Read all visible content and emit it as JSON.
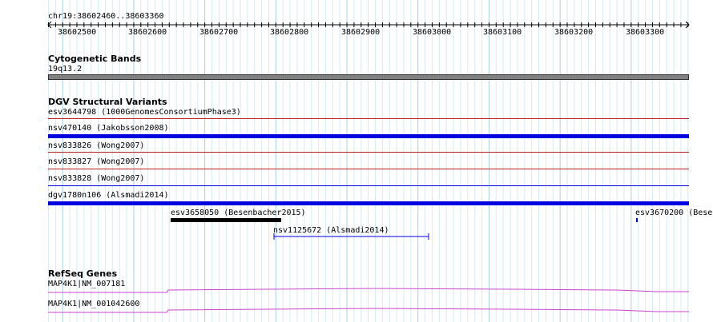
{
  "ruler": {
    "region_label": "chr19:38602460..38603360",
    "ticks": [
      "38602500",
      "38602600",
      "38602700",
      "38602800",
      "38602900",
      "38603000",
      "38603100",
      "38603200",
      "38603300"
    ]
  },
  "cytoband": {
    "title": "Cytogenetic Bands",
    "band_label": "19q13.2"
  },
  "dgv": {
    "title": "DGV Structural Variants",
    "items": [
      {
        "label": "esv3644798 (1000GenomesConsortiumPhase3)",
        "color": "#b22222"
      },
      {
        "label": "nsv470140 (Jakobsson2008)",
        "color": "#0000e0"
      },
      {
        "label": "nsv833826 (Wong2007)",
        "color": "#b22222"
      },
      {
        "label": "nsv833827 (Wong2007)",
        "color": "#b22222"
      },
      {
        "label": "nsv833828 (Wong2007)",
        "color": "#0000e0"
      },
      {
        "label": "dgv1780n106 (Alsmadi2014)",
        "color": "#0000e0"
      },
      {
        "label": "esv3658050 (Besenbacher2015)",
        "color": "#000000"
      },
      {
        "label": "nsv1125672 (Alsmadi2014)",
        "color": "#0000e0"
      },
      {
        "label": "esv3670200 (Bese",
        "color": "#0000e0"
      }
    ]
  },
  "refseq": {
    "title": "RefSeq Genes",
    "genes": [
      {
        "label": "MAP4K1|NM_007181",
        "color": "#cc44cc"
      },
      {
        "label": "MAP4K1|NM_001042600",
        "color": "#cc44cc"
      }
    ]
  }
}
